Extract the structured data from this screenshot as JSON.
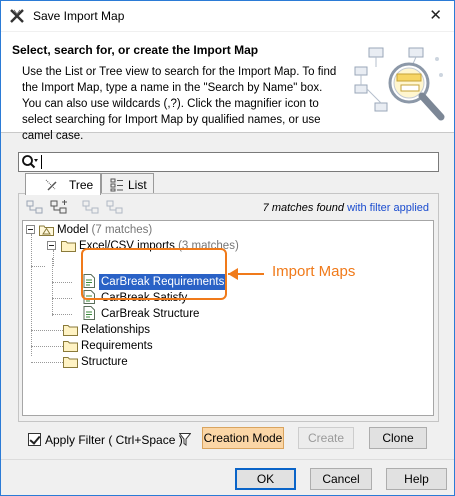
{
  "window": {
    "title": "Save Import Map",
    "close_glyph": "✕"
  },
  "header": {
    "title": "Select, search for, or create the Import Map",
    "description": "Use the List or Tree view to search for the Import Map. To find the Import Map, type a name in the \"Search by Name\" box. You can also use wildcards (,?). Click the magnifier icon to select searching for Import Map by qualified names, or use camel case."
  },
  "search": {
    "value": "",
    "icon": "magnifier-icon"
  },
  "tabs": [
    {
      "label": "Tree",
      "icon": "tree-icon",
      "active": true
    },
    {
      "label": "List",
      "icon": "list-icon",
      "active": false
    }
  ],
  "toolbar": {
    "icons": [
      "expand-all-icon",
      "collapse-all-icon",
      "move-up-icon",
      "move-down-icon"
    ]
  },
  "matches": {
    "count_text": "7 matches found",
    "filter_link": "with filter applied"
  },
  "tree": {
    "model": {
      "label": "Model",
      "count": "(7 matches)"
    },
    "excel": {
      "label": "Excel/CSV imports",
      "count": "(3 matches)"
    },
    "maps": [
      {
        "label": "CarBreak Requirements",
        "selected": true
      },
      {
        "label": "CarBreak Satisfy",
        "selected": false
      },
      {
        "label": "CarBreak Structure",
        "selected": false
      }
    ],
    "folders": [
      {
        "label": "Relationships"
      },
      {
        "label": "Requirements"
      },
      {
        "label": "Structure"
      }
    ]
  },
  "callout": {
    "text": "Import Maps",
    "color": "#f07a1a"
  },
  "filter": {
    "checked": true,
    "label": "Apply Filter ( Ctrl+Space )"
  },
  "buttons": {
    "creation_mode": "Creation Mode",
    "create": "Create",
    "clone": "Clone",
    "ok": "OK",
    "cancel": "Cancel",
    "help": "Help"
  },
  "colors": {
    "selection": "#2a62c6",
    "link": "#1a4ccf",
    "creation_mode_bg": "#fbd6a6"
  }
}
